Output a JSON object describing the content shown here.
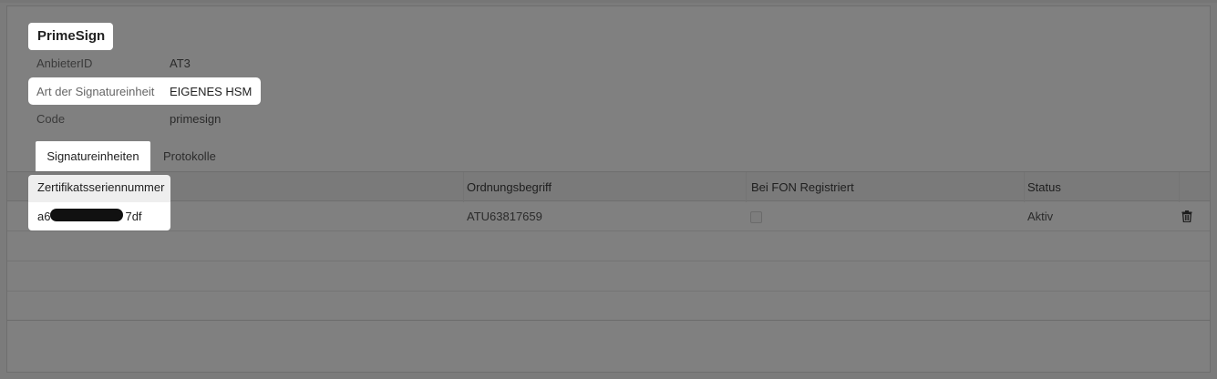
{
  "provider": {
    "title": "PrimeSign",
    "fields": [
      {
        "label": "AnbieterID",
        "value": "AT3"
      },
      {
        "label": "Art der Signatureinheit",
        "value": "EIGENES HSM"
      },
      {
        "label": "Code",
        "value": "primesign"
      }
    ]
  },
  "tabs": [
    {
      "label": "Signatureinheiten",
      "active": true
    },
    {
      "label": "Protokolle",
      "active": false
    }
  ],
  "table": {
    "columns": [
      "Zertifikatsseriennummer",
      "Ordnungsbegriff",
      "Bei FON Registriert",
      "Status"
    ],
    "rows": [
      {
        "serial_prefix": "a6",
        "serial_suffix": "7df",
        "ordnungsbegriff": "ATU63817659",
        "fon_registered": false,
        "status": "Aktiv"
      }
    ]
  },
  "icons": {
    "delete": "trash-icon"
  }
}
